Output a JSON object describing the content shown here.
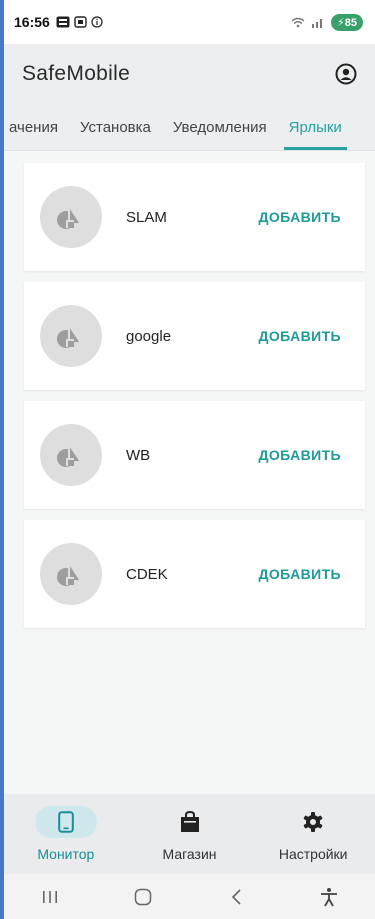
{
  "status_bar": {
    "time": "16:56",
    "battery": "85"
  },
  "app": {
    "title": "SafeMobile"
  },
  "tabs": [
    {
      "label": "ачения",
      "active": false
    },
    {
      "label": "Установка",
      "active": false
    },
    {
      "label": "Уведомления",
      "active": false
    },
    {
      "label": "Ярлыки",
      "active": true
    }
  ],
  "shortcuts": [
    {
      "name": "SLAM",
      "action": "ДОБАВИТЬ"
    },
    {
      "name": "google",
      "action": "ДОБАВИТЬ"
    },
    {
      "name": "WB",
      "action": "ДОБАВИТЬ"
    },
    {
      "name": "CDEK",
      "action": "ДОБАВИТЬ"
    }
  ],
  "bottom_nav": [
    {
      "label": "Монитор",
      "icon": "phone-icon",
      "active": true
    },
    {
      "label": "Магазин",
      "icon": "shopping-bag-icon",
      "active": false
    },
    {
      "label": "Настройки",
      "icon": "gear-icon",
      "active": false
    }
  ],
  "colors": {
    "accent": "#26a2a2",
    "battery": "#39a06a"
  }
}
